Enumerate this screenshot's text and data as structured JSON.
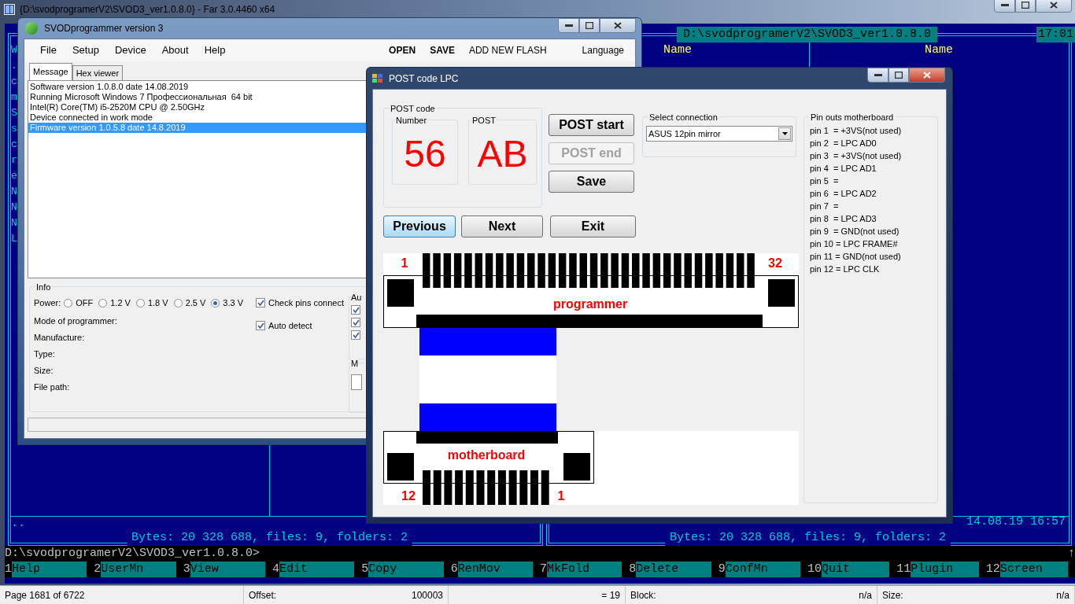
{
  "far": {
    "title": "{D:\\svodprogramerV2\\SVOD3_ver1.0.8.0} - Far 3.0.4460 x64",
    "right_panel_path": "D:\\svodprogramerV2\\SVOD3_ver1.0.8.0",
    "clock": "17:01",
    "column_headers": [
      "Name",
      "Name"
    ],
    "left_panel_fragments": [
      "W",
      ".",
      "c",
      "m",
      "S",
      "s",
      "c",
      "r",
      "e",
      "N",
      "N",
      "N",
      "L"
    ],
    "up_entry": "..",
    "file_datetime": "14.08.19 16:57",
    "totals": [
      "Bytes: 20 328 688, files: 9, folders: 2",
      "Bytes: 20 328 688, files: 9, folders: 2"
    ],
    "command_line": "D:\\svodprogramerV2\\SVOD3_ver1.0.8.0>",
    "scroll_mark": "↑",
    "keybar": [
      {
        "num": "1",
        "label": "Help"
      },
      {
        "num": "2",
        "label": "UserMn"
      },
      {
        "num": "3",
        "label": "View"
      },
      {
        "num": "4",
        "label": "Edit"
      },
      {
        "num": "5",
        "label": "Copy"
      },
      {
        "num": "6",
        "label": "RenMov"
      },
      {
        "num": "7",
        "label": "MkFold"
      },
      {
        "num": "8",
        "label": "Delete"
      },
      {
        "num": "9",
        "label": "ConfMn"
      },
      {
        "num": "10",
        "label": "Quit"
      },
      {
        "num": "11",
        "label": "Plugin"
      },
      {
        "num": "12",
        "label": "Screen"
      }
    ]
  },
  "viewer_status_bar": [
    {
      "label": "Page 1681 of 6722"
    },
    {
      "label": "Offset:",
      "value": "100003"
    },
    {
      "value": "= 19"
    },
    {
      "label": "Block:",
      "value": "n/a"
    },
    {
      "label": "Size:",
      "value": "n/a"
    }
  ],
  "svod": {
    "title": "SVODprogrammer version 3",
    "menu": [
      "File",
      "Setup",
      "Device",
      "About",
      "Help"
    ],
    "actions": [
      "OPEN",
      "SAVE",
      "ADD NEW FLASH"
    ],
    "language": "Language",
    "tabs": [
      {
        "label": "Message",
        "selected": true
      },
      {
        "label": "Hex viewer",
        "selected": false
      }
    ],
    "messages": [
      {
        "text": "Software version 1.0.8.0 date 14.08.2019",
        "selected": false
      },
      {
        "text": "Running Microsoft Windows 7 Профессиональная  64 bit",
        "selected": false
      },
      {
        "text": "Intel(R) Core(TM) i5-2520M CPU @ 2.50GHz",
        "selected": false
      },
      {
        "text": "Device connected in work mode",
        "selected": false
      },
      {
        "text": "Firmware version 1.0.5.8 date 14.8.2019",
        "selected": true
      }
    ],
    "info": {
      "title": "Info",
      "power_label": "Power:",
      "power_options": [
        {
          "label": "OFF",
          "selected": false
        },
        {
          "label": "1.2 V",
          "selected": false
        },
        {
          "label": "1.8 V",
          "selected": false
        },
        {
          "label": "2.5 V",
          "selected": false
        },
        {
          "label": "3.3 V",
          "selected": true
        }
      ],
      "fields": [
        "Mode of programmer:",
        "Manufacture:",
        "Type:",
        "Size:",
        "File path:"
      ],
      "checks": [
        {
          "label": "Check pins connect",
          "checked": true
        },
        {
          "label": "Auto detect",
          "checked": true
        }
      ],
      "side_groups": [
        {
          "title": "Au",
          "checks": [
            true,
            true,
            true
          ]
        },
        {
          "title": "M"
        }
      ]
    }
  },
  "post_dialog": {
    "title": "POST code LPC",
    "group_title": "POST code",
    "number": {
      "label": "Number",
      "value": "56"
    },
    "post": {
      "label": "POST",
      "value": "AB"
    },
    "buttons": [
      {
        "label": "POST start",
        "disabled": false,
        "focused": false
      },
      {
        "label": "POST end",
        "disabled": true,
        "focused": false
      },
      {
        "label": "Save",
        "disabled": false,
        "focused": false
      }
    ],
    "nav_buttons": [
      {
        "label": "Previous",
        "disabled": false,
        "focused": true
      },
      {
        "label": "Next",
        "disabled": false,
        "focused": false
      },
      {
        "label": "Exit",
        "disabled": false,
        "focused": false
      }
    ],
    "connection": {
      "title": "Select connection",
      "value": "ASUS 12pin mirror"
    },
    "pinouts": {
      "title": "Pin outs motherboard",
      "pins": [
        "pin 1  = +3VS(not used)",
        "pin 2  = LPC AD0",
        "pin 3  = +3VS(not used)",
        "pin 4  = LPC AD1",
        "pin 5  =",
        "pin 6  = LPC AD2",
        "pin 7  =",
        "pin 8  = LPC AD3",
        "pin 9  = GND(not used)",
        "pin 10 = LPC FRAME#",
        "pin 11 = GND(not used)",
        "pin 12 = LPC CLK"
      ]
    },
    "diagram": {
      "programmer_label": "programmer",
      "programmer_first_pin": "1",
      "programmer_last_pin": "32",
      "motherboard_label": "motherboard",
      "motherboard_first_pin": "12",
      "motherboard_last_pin": "1"
    }
  }
}
